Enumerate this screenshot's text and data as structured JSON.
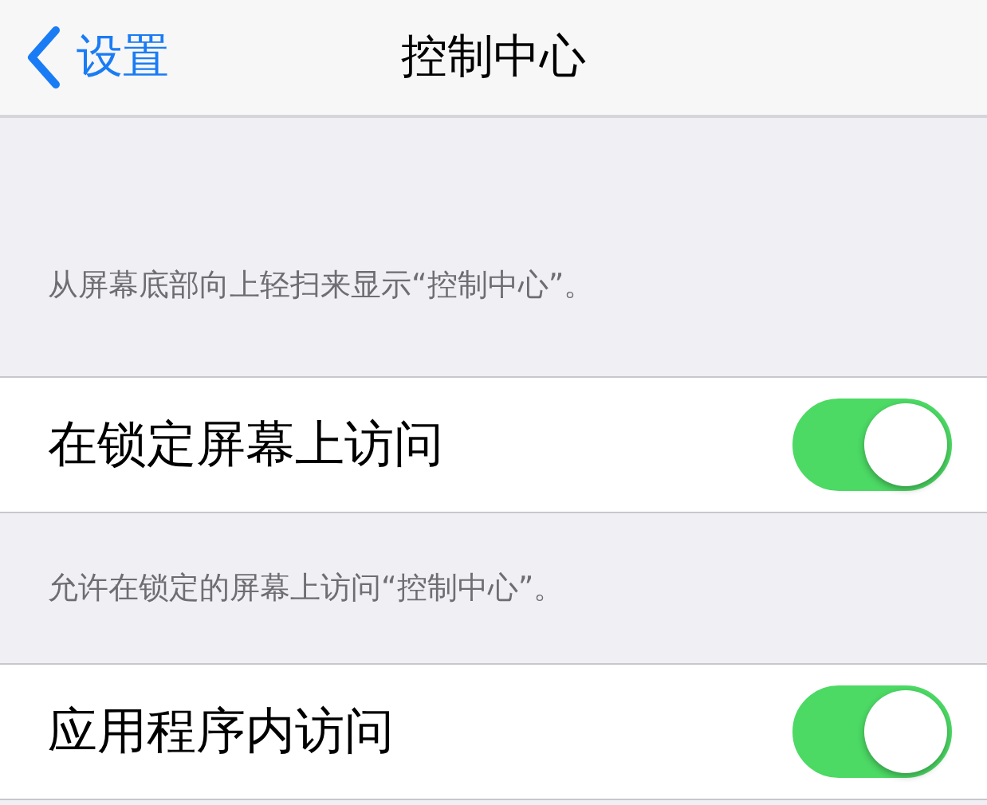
{
  "nav": {
    "back": "设置",
    "title": "控制中心"
  },
  "sections": [
    {
      "footer_above": "从屏幕底部向上轻扫来显示“控制中心”。",
      "label": "在锁定屏幕上访问",
      "on": true
    },
    {
      "footer_above": "允许在锁定的屏幕上访问“控制中心”。",
      "label": "应用程序内访问",
      "on": true
    }
  ]
}
